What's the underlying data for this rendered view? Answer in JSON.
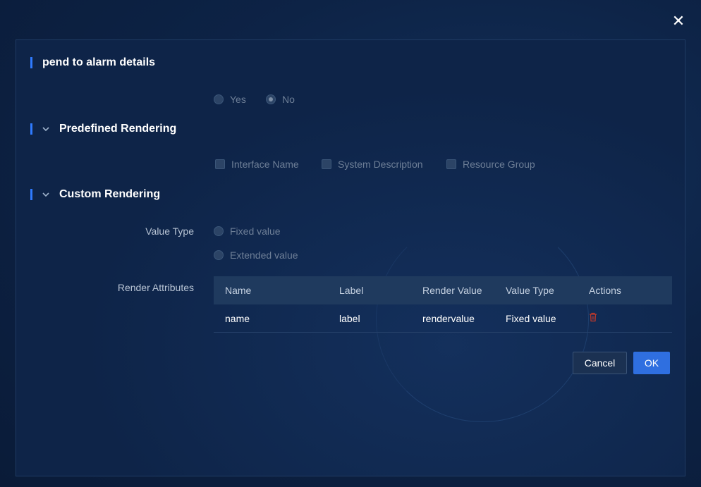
{
  "dialog": {
    "close_symbol": "✕",
    "section_alarm": "pend to alarm details",
    "alarm_options": [
      {
        "label": "Yes",
        "checked": false
      },
      {
        "label": "No",
        "checked": true
      }
    ],
    "section_predefined": "Predefined Rendering",
    "predefined_options": [
      "Interface Name",
      "System Description",
      "Resource Group"
    ],
    "section_custom": "Custom Rendering",
    "value_type_label": "Value Type",
    "value_type_options": [
      "Fixed value",
      "Extended value"
    ],
    "render_attributes_label": "Render Attributes",
    "table": {
      "headers": [
        "Name",
        "Label",
        "Render Value",
        "Value Type",
        "Actions"
      ],
      "rows": [
        {
          "name": "name",
          "label": "label",
          "render_value": "rendervalue",
          "value_type": "Fixed value"
        }
      ]
    },
    "buttons": {
      "cancel": "Cancel",
      "ok": "OK"
    }
  },
  "colors": {
    "accent": "#2f7bff",
    "primary_button": "#2f6fe0",
    "danger_icon": "#c0392b"
  },
  "icons": {
    "close": "close-icon",
    "chevron": "chevron-down-icon",
    "delete": "trash-icon"
  }
}
